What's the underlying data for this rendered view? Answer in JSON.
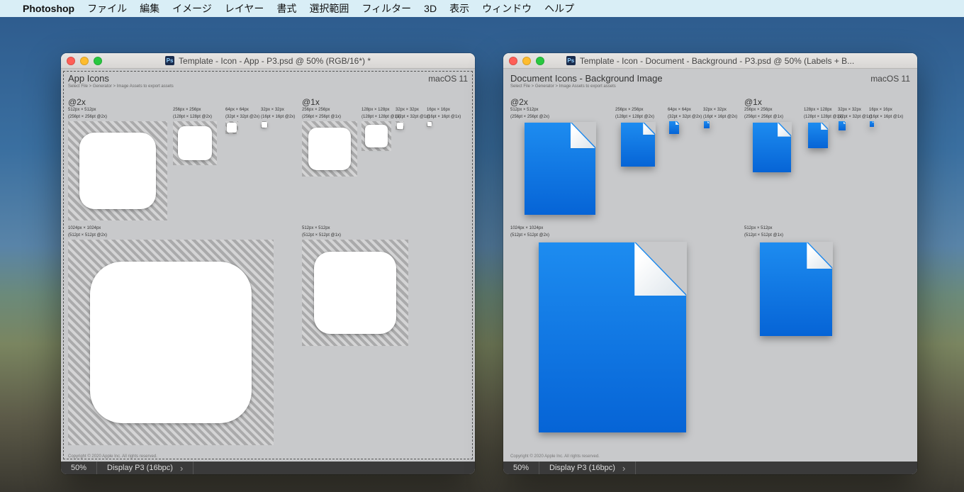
{
  "menubar": {
    "app": "Photoshop",
    "items": [
      "ファイル",
      "編集",
      "イメージ",
      "レイヤー",
      "書式",
      "選択範囲",
      "フィルター",
      "3D",
      "表示",
      "ウィンドウ",
      "ヘルプ"
    ]
  },
  "windows": [
    {
      "title": "Template - Icon - App - P3.psd @ 50% (RGB/16*) *",
      "header": "App Icons",
      "sub": "Select File > Generator > Image Assets to export assets",
      "os": "macOS 11",
      "at2x": "@2x",
      "at1x": "@1x",
      "copyright": "Copyright © 2020 Apple Inc. All rights reserved.",
      "zoom": "50%",
      "profile": "Display P3 (16bpc)",
      "slots2x": [
        {
          "l1": "512px × 512px",
          "l2": "(256pt × 256pt @2x)"
        },
        {
          "l1": "256px × 256px",
          "l2": "(128pt × 128pt @2x)"
        },
        {
          "l1": "64px × 64px",
          "l2": "(32pt × 32pt @2x)"
        },
        {
          "l1": "32px × 32px",
          "l2": "(16pt × 16pt @2x)"
        }
      ],
      "slots1x": [
        {
          "l1": "256px × 256px",
          "l2": "(256pt × 256pt @1x)"
        },
        {
          "l1": "128px × 128px",
          "l2": "(128pt × 128pt @1x)"
        },
        {
          "l1": "32px × 32px",
          "l2": "(32pt × 32pt @1x)"
        },
        {
          "l1": "16px × 16px",
          "l2": "(16pt × 16pt @1x)"
        }
      ],
      "big2x": {
        "l1": "1024px × 1024px",
        "l2": "(512pt × 512pt @2x)"
      },
      "big1x": {
        "l1": "512px × 512px",
        "l2": "(512pt × 512pt @1x)"
      }
    },
    {
      "title": "Template - Icon - Document - Background - P3.psd @ 50% (Labels + B...",
      "header": "Document Icons - Background Image",
      "sub": "Select File > Generator > Image Assets to export assets",
      "os": "macOS 11",
      "at2x": "@2x",
      "at1x": "@1x",
      "copyright": "Copyright © 2020 Apple Inc. All rights reserved.",
      "zoom": "50%",
      "profile": "Display P3 (16bpc)",
      "slots2x": [
        {
          "l1": "512px × 512px",
          "l2": "(256pt × 256pt @2x)"
        },
        {
          "l1": "256px × 256px",
          "l2": "(128pt × 128pt @2x)"
        },
        {
          "l1": "64px × 64px",
          "l2": "(32pt × 32pt @2x)"
        },
        {
          "l1": "32px × 32px",
          "l2": "(16pt × 16pt @2x)"
        }
      ],
      "slots1x": [
        {
          "l1": "256px × 256px",
          "l2": "(256pt × 256pt @1x)"
        },
        {
          "l1": "128px × 128px",
          "l2": "(128pt × 128pt @1x)"
        },
        {
          "l1": "32px × 32px",
          "l2": "(32pt × 32pt @1x)"
        },
        {
          "l1": "16px × 16px",
          "l2": "(16pt × 16pt @1x)"
        }
      ],
      "big2x": {
        "l1": "1024px × 1024px",
        "l2": "(512pt × 512pt @2x)"
      },
      "big1x": {
        "l1": "512px × 512px",
        "l2": "(512pt × 512pt @1x)"
      }
    }
  ]
}
